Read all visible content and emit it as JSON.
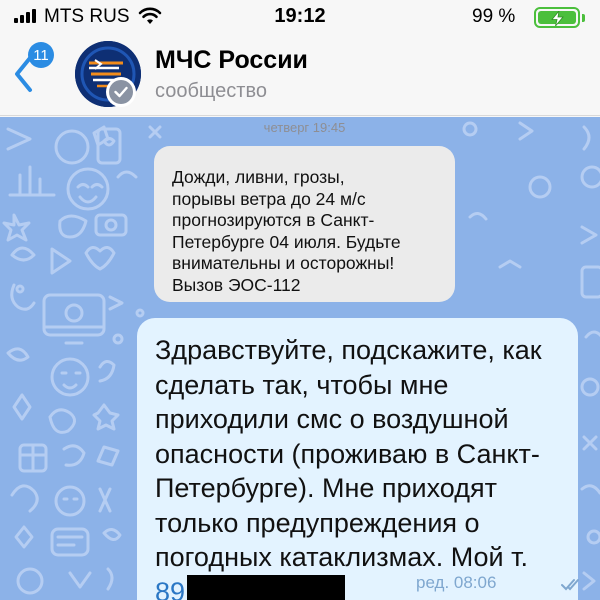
{
  "status_bar": {
    "carrier": "MTS RUS",
    "time": "19:12",
    "battery_percent": "99 %",
    "colors": {
      "battery": "#4bbf3c"
    },
    "icons": [
      "signal-icon",
      "wifi-icon",
      "battery-icon",
      "charging-bolt-icon"
    ]
  },
  "header": {
    "unread_count": "11",
    "title": "МЧС России",
    "subtitle": "сообщество",
    "colors": {
      "badge": "#2b8ce3",
      "avatar": "#0e2f74"
    },
    "icons": [
      "back-chevron-icon",
      "verified-check-icon"
    ]
  },
  "messages": {
    "incoming": {
      "date": "четверг 19:45",
      "text": "Дожди, ливни, грозы,\nпорывы ветра до 24 м/с\nпрогнозируются в Санкт-\nПетербурге 04 июля. Будьте\nвнимательны и осторожны!\nВызов ЭОС-112"
    },
    "outgoing": {
      "text": "Здравствуйте, подскажите, как\nсделать так, чтобы мне\nприходили смс о воздушной\nопасности (проживаю в Санкт-\nПетербурге). Мне приходят\nтолько предупреждения о\nпогодных катаклизмах. Мой т.",
      "phone_prefix": "89",
      "meta": "ред. 08:06",
      "colors": {
        "bubble": "#e3f3ff",
        "link": "#2b77c5"
      },
      "icons": [
        "double-check-icon"
      ]
    }
  },
  "chat_background": {
    "color": "#8cb2e8"
  }
}
